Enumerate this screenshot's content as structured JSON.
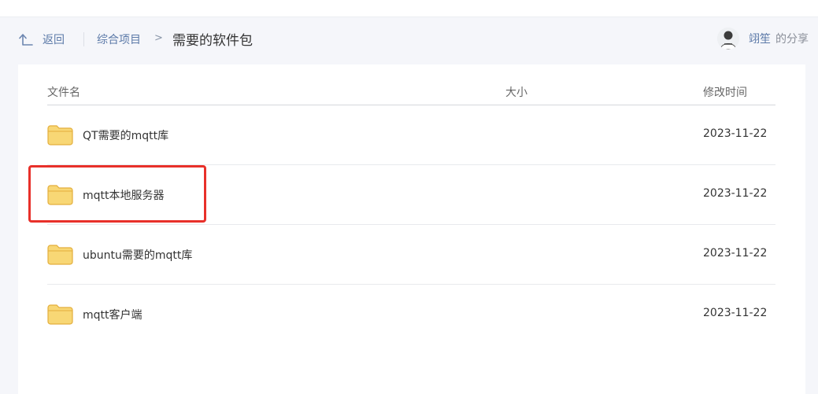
{
  "header": {
    "back_label": "返回",
    "breadcrumb_parent": "综合项目",
    "breadcrumb_separator": ">",
    "breadcrumb_current": "需要的软件包",
    "user_name": "翊笙",
    "share_suffix": "的分享"
  },
  "table": {
    "columns": {
      "name": "文件名",
      "size": "大小",
      "modified": "修改时间"
    },
    "rows": [
      {
        "name": "QT需要的mqtt库",
        "size": "",
        "date": "2023-11-22"
      },
      {
        "name": "mqtt本地服务器",
        "size": "",
        "date": "2023-11-22"
      },
      {
        "name": "ubuntu需要的mqtt库",
        "size": "",
        "date": "2023-11-22"
      },
      {
        "name": "mqtt客户端",
        "size": "",
        "date": "2023-11-22"
      }
    ]
  },
  "highlight": {
    "target_row": 1,
    "color": "#e8302a"
  },
  "colors": {
    "link": "#5b79a8",
    "folder_fill": "#f8d775",
    "folder_border": "#e3ae3c",
    "highlight": "#e8302a"
  },
  "icons": {
    "back": "back-arrow-icon",
    "folder": "folder-icon",
    "avatar": "user-avatar"
  }
}
